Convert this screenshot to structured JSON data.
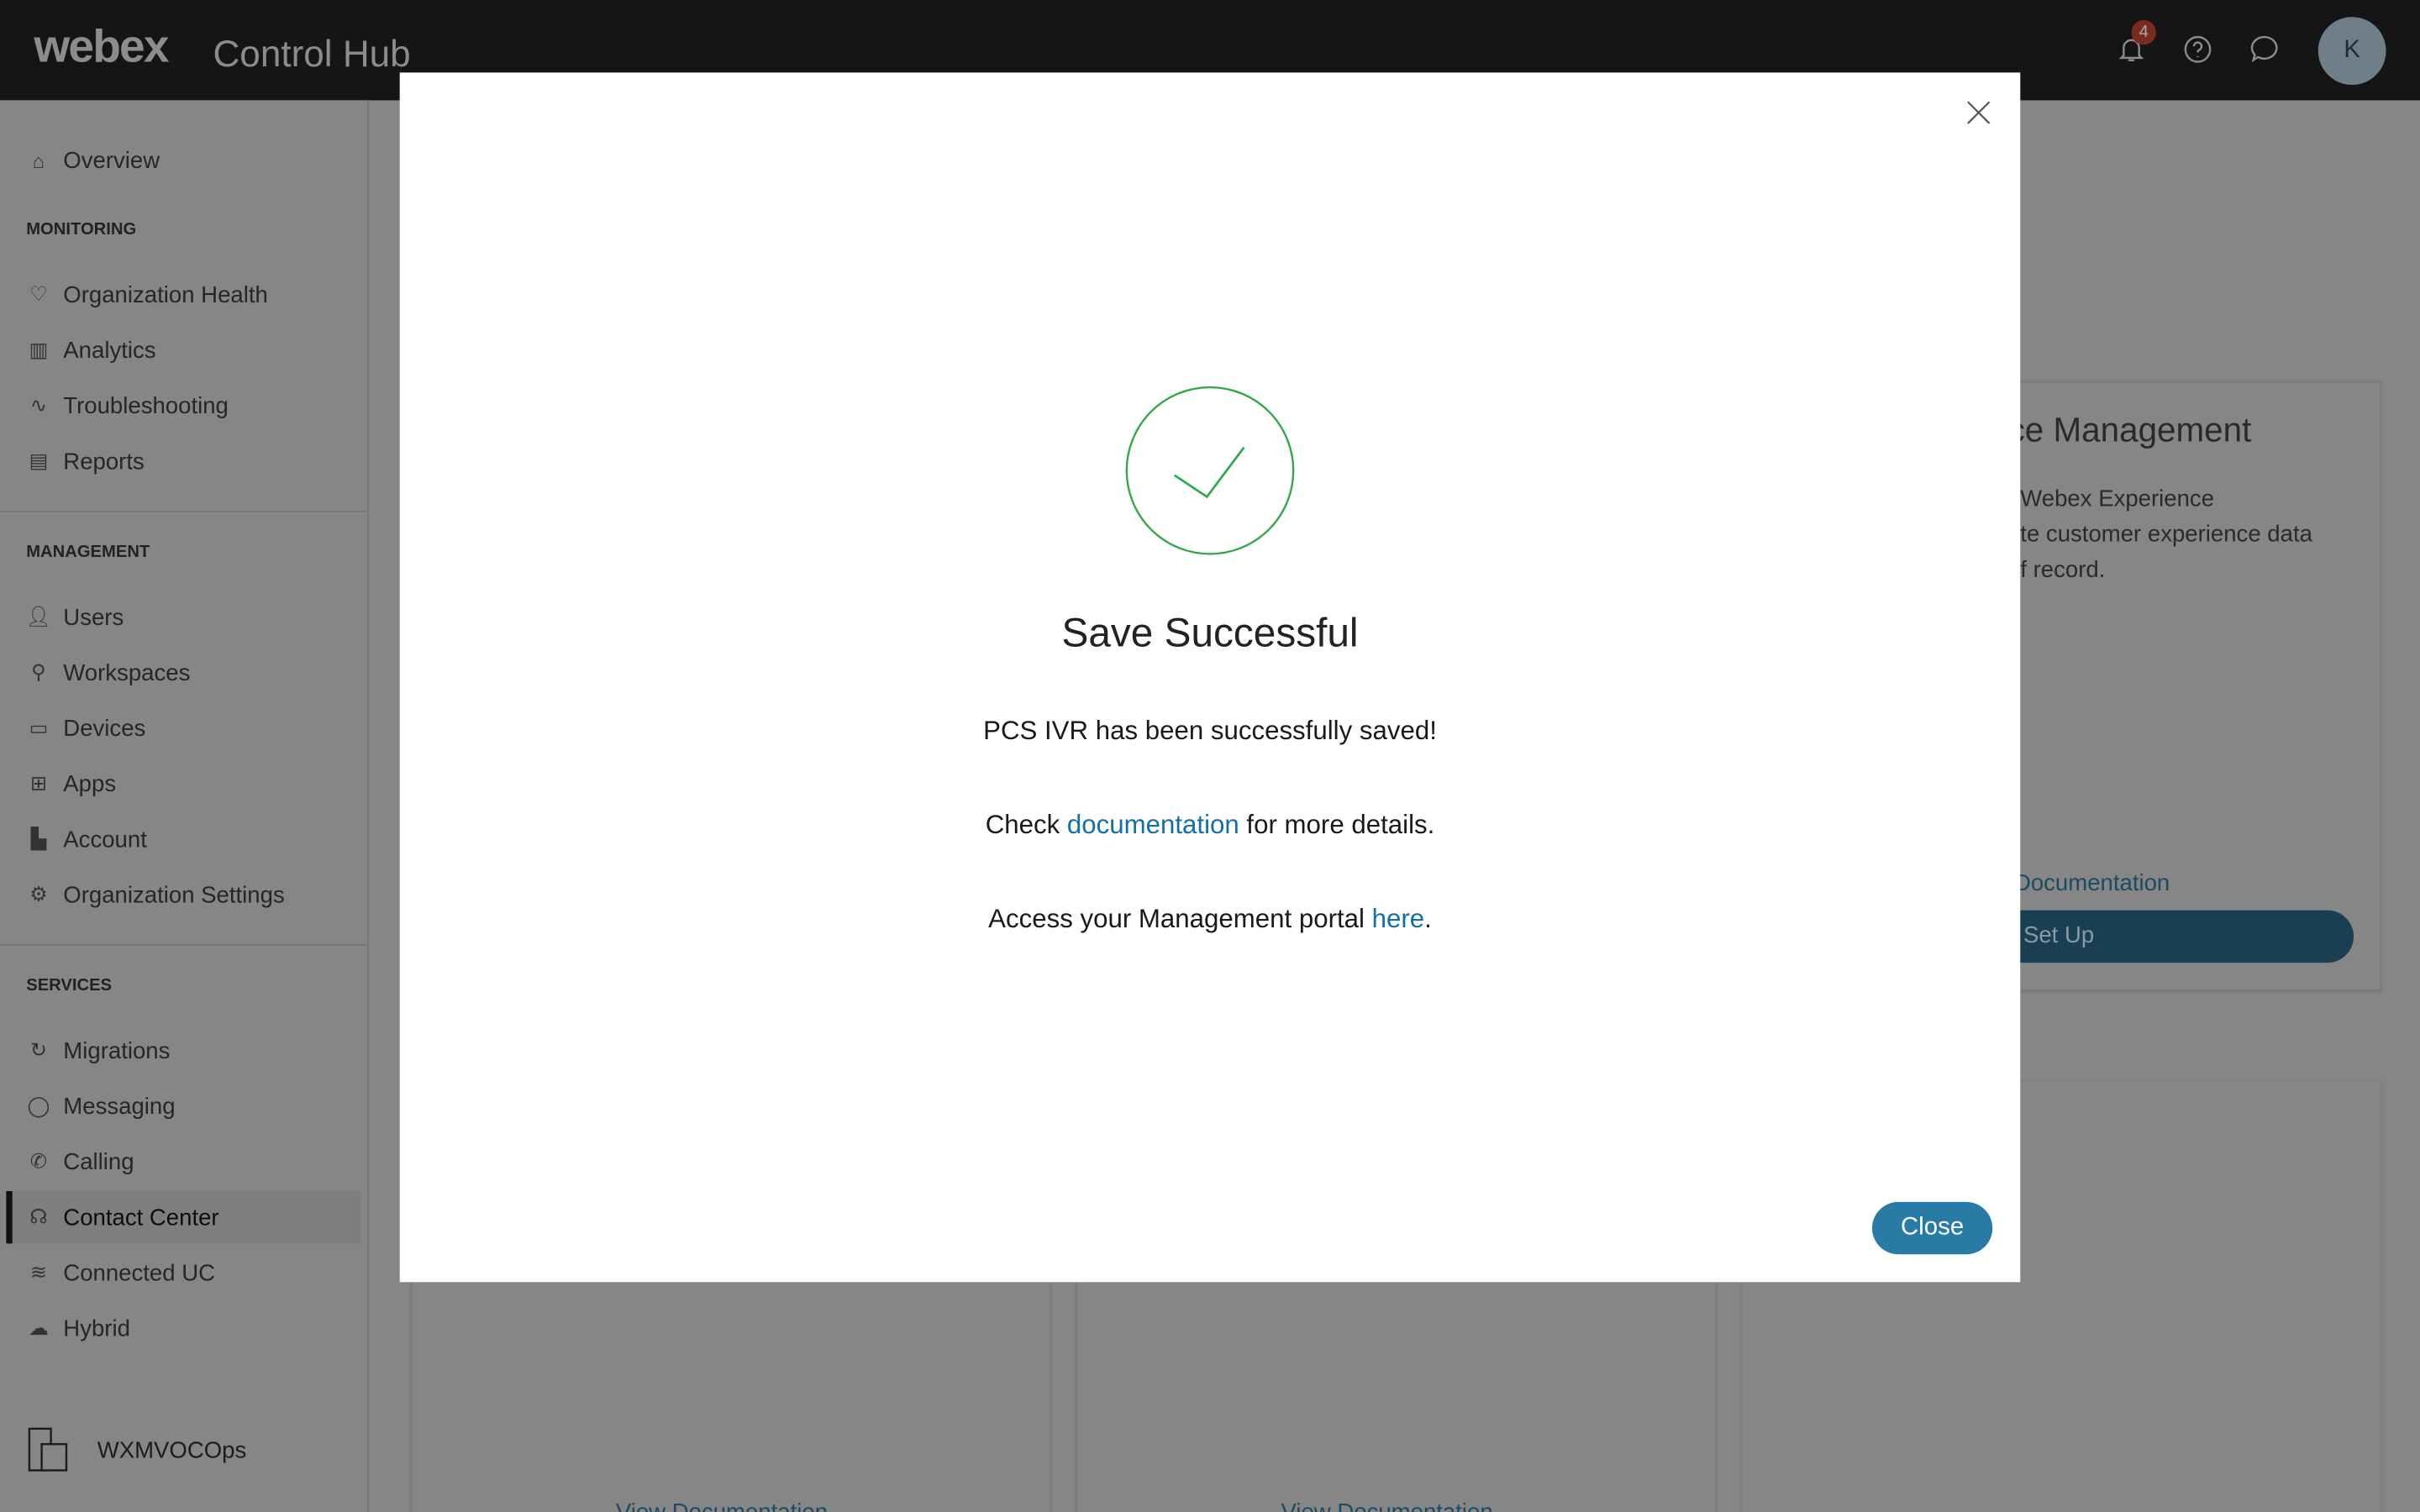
{
  "header": {
    "logo": "webex",
    "product": "Control Hub",
    "notification_count": "4",
    "avatar_initial": "K"
  },
  "sidebar": {
    "overview": "Overview",
    "sections": [
      {
        "title": "MONITORING",
        "items": [
          "Organization Health",
          "Analytics",
          "Troubleshooting",
          "Reports"
        ]
      },
      {
        "title": "MANAGEMENT",
        "items": [
          "Users",
          "Workspaces",
          "Devices",
          "Apps",
          "Account",
          "Organization Settings"
        ]
      },
      {
        "title": "SERVICES",
        "items": [
          "Migrations",
          "Messaging",
          "Calling",
          "Contact Center",
          "Connected UC",
          "Hybrid"
        ]
      }
    ],
    "active_item": "Contact Center",
    "org_name": "WXMVOCOps"
  },
  "background": {
    "card_title": "ce Management",
    "card_desc": [
      "Webex Experience",
      "te customer experience data",
      "f record."
    ],
    "card_link": "Documentation",
    "card_button": "Set Up",
    "bottom_links": [
      "View Documentation",
      "View Documentation"
    ]
  },
  "modal": {
    "title": "Save Successful",
    "message": "PCS IVR has been successfully saved!",
    "doc_prefix": "Check ",
    "doc_link": "documentation",
    "doc_suffix": " for more details.",
    "portal_prefix": "Access your Management portal ",
    "portal_link": "here",
    "portal_suffix": ".",
    "close_button": "Close"
  },
  "colors": {
    "accent": "#2a7aa6",
    "success": "#2fa84f",
    "link": "#1170a8",
    "header": "#151515"
  }
}
